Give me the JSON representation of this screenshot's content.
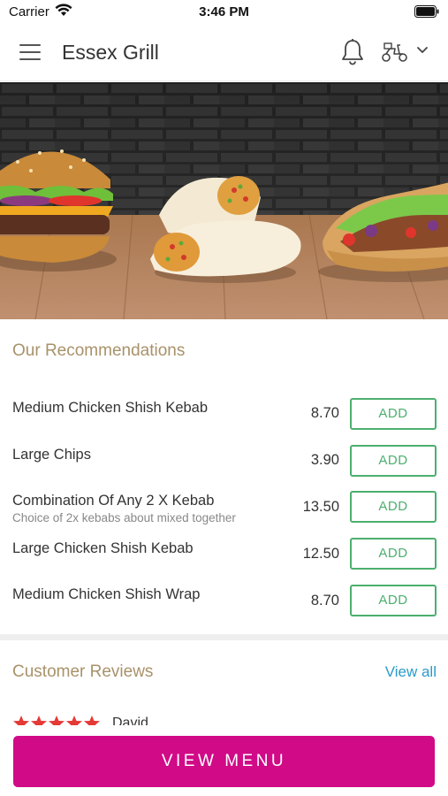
{
  "status_bar": {
    "carrier": "Carrier",
    "time": "3:46 PM"
  },
  "header": {
    "title": "Essex Grill",
    "icons": [
      "menu-icon",
      "bell-icon",
      "scooter-icon",
      "chevron-down-icon"
    ]
  },
  "recommendations": {
    "title": "Our Recommendations",
    "add_label": "ADD",
    "items": [
      {
        "name": "Medium Chicken Shish Kebab",
        "description": "",
        "price": "8.70"
      },
      {
        "name": "Large Chips",
        "description": "",
        "price": "3.90"
      },
      {
        "name": "Combination Of Any 2 X Kebab",
        "description": "Choice of 2x kebabs about mixed together",
        "price": "13.50"
      },
      {
        "name": "Large Chicken Shish Kebab",
        "description": "",
        "price": "12.50"
      },
      {
        "name": "Medium Chicken Shish Wrap",
        "description": "",
        "price": "8.70"
      }
    ]
  },
  "reviews": {
    "title": "Customer Reviews",
    "view_all_label": "View all",
    "first_review": {
      "reviewer": "David",
      "rating": 5
    }
  },
  "bottom": {
    "view_menu_label": "VIEW MENU"
  },
  "colors": {
    "accent": "#d10a87",
    "add_green": "#4caf6e",
    "section_title": "#a8926a",
    "link": "#2a9bc9",
    "star": "#e53935"
  }
}
